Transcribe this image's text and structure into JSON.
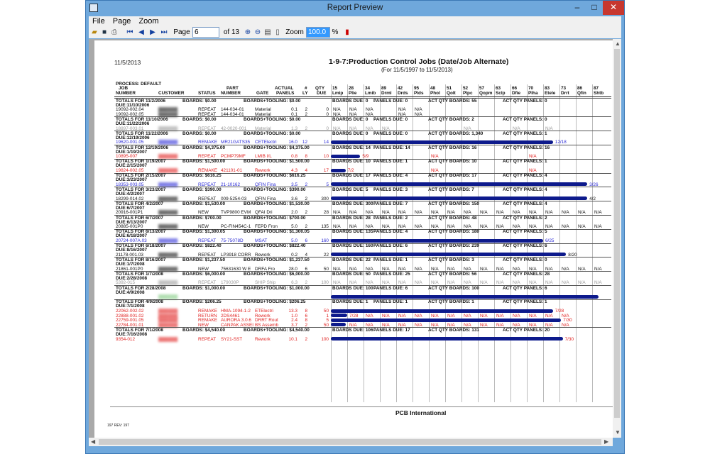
{
  "window": {
    "title": "Report Preview",
    "minimize": "–",
    "maximize": "□",
    "close": "✕"
  },
  "menu": [
    "File",
    "Page",
    "Zoom"
  ],
  "toolbar": {
    "page_label": "Page",
    "page_value": "6",
    "of_label": "of 13",
    "zoom_label": "Zoom",
    "zoom_value": "100.0",
    "percent": "%"
  },
  "report": {
    "date": "11/5/2013",
    "title": "1-9-7:Production Control Jobs (Date/Job Alternate)",
    "subtitle": "(For 11/5/1997 to 11/5/2013)",
    "process": "PROCESS: DEFAULT",
    "footer_company": "PCB International",
    "footer_rev": "197  REV:  197"
  },
  "columns": {
    "job": "JOB",
    "job2": "NUMBER",
    "customer": "CUSTOMER",
    "status": "STATUS",
    "part": "PART",
    "part2": "NUMBER",
    "gate": "GATE",
    "actual": "ACTUAL",
    "panels": "PANELS",
    "num": "#",
    "ly": "LY",
    "qty": "QTY",
    "due": "DUE",
    "stations": [
      {
        "n": "15",
        "name": "Lmip"
      },
      {
        "n": "28",
        "name": "Plie"
      },
      {
        "n": "34",
        "name": "Lmib"
      },
      {
        "n": "89",
        "name": "Drml"
      },
      {
        "n": "42",
        "name": "Drds"
      },
      {
        "n": "95",
        "name": "Plds"
      },
      {
        "n": "48",
        "name": "Phol"
      },
      {
        "n": "51",
        "name": "Qolt"
      },
      {
        "n": "52",
        "name": "Plpc"
      },
      {
        "n": "57",
        "name": "Qopm"
      },
      {
        "n": "63",
        "name": "Sclp"
      },
      {
        "n": "66",
        "name": "Dfie"
      },
      {
        "n": "70",
        "name": "Plha"
      },
      {
        "n": "83",
        "name": "Etele"
      },
      {
        "n": "73",
        "name": "Drrt"
      },
      {
        "n": "86",
        "name": "Qfin"
      },
      {
        "n": "87",
        "name": "Shtb"
      }
    ]
  },
  "rows": [
    {
      "t": "total",
      "text": "TOTALS FOR 11/2/2006",
      "boards": "BOARDS: $0.00",
      "tool": "BOARDS+TOOLING: $0.00",
      "bd": "BOARDS DUE: 0",
      "pd": "PANELS DUE: 0",
      "aqb": "ACT QTY BOARDS: 55",
      "aqp": "ACT QTY PANELS: 0"
    },
    {
      "t": "due",
      "text": "DUE:11/10/2006"
    },
    {
      "t": "job",
      "c": "#111",
      "job": "19092-002.04",
      "st": "REPEAT",
      "part": "144-034-01",
      "gate": "Material",
      "act": "0.1",
      "n": "2",
      "qty": "0",
      "cells": [
        "N/A",
        "N/A",
        "N/A",
        "",
        "N/A",
        "N/A"
      ]
    },
    {
      "t": "job",
      "c": "#111",
      "job": "19092-002.05",
      "st": "REPEAT",
      "part": "144-034-01",
      "gate": "Material",
      "act": "0.1",
      "n": "2",
      "qty": "0",
      "cells": [
        "N/A",
        "N/A",
        "N/A",
        "",
        "N/A",
        "N/A"
      ]
    },
    {
      "t": "total",
      "text": "TOTALS FOR 11/10/2006",
      "boards": "BOARDS: $0.00",
      "tool": "BOARDS+TOOLING: $0.00",
      "bd": "BOARDS DUE: 0",
      "pd": "PANELS DUE: 0",
      "aqb": "ACT QTY BOARDS: 2",
      "aqp": "ACT QTY PANELS: 0"
    },
    {
      "t": "due",
      "text": "DUE:11/22/2006"
    },
    {
      "t": "job",
      "c": "#999",
      "job": "18897-003.01",
      "st": "REPEAT",
      "part": "42-0020-001",
      "gate": "Material",
      "act": "1.3",
      "n": "2",
      "qty": "0",
      "cells": [
        "N/A",
        "N/A",
        "N/A",
        "N/A",
        "",
        "",
        "",
        "",
        "N/A",
        "",
        "",
        "N/A",
        "",
        "N/A"
      ]
    },
    {
      "t": "total",
      "text": "TOTALS FOR 11/22/2006",
      "boards": "BOARDS: $0.00",
      "tool": "BOARDS+TOOLING: $0.00",
      "bd": "BOARDS DUE: 0",
      "pd": "PANELS DUE: 0",
      "aqb": "ACT QTY BOARDS: 1,340",
      "aqp": "ACT QTY PANELS: 1"
    },
    {
      "t": "due",
      "text": "DUE:12/19/2006"
    },
    {
      "t": "job",
      "c": "#2b2bd6",
      "job": "19620-001.05",
      "st": "REMAKE",
      "part": "MR21GATS35",
      "gate": "CETElectri",
      "act": "16.0",
      "n": "12",
      "qty": "14",
      "bar": [
        0,
        13.6
      ],
      "lbl": "12/18"
    },
    {
      "t": "total",
      "text": "TOTALS FOR 12/19/2006",
      "boards": "BOARDS: $4,375.00",
      "tool": "BOARDS+TOOLING: $4,375.00",
      "bd": "BOARDS DUE: 14",
      "pd": "PANELS DUE: 14",
      "aqb": "ACT QTY BOARDS: 16",
      "aqp": "ACT QTY PANELS: 16"
    },
    {
      "t": "due",
      "text": "DUE:1/19/2007"
    },
    {
      "t": "job",
      "c": "#e0201f",
      "job": "10895-007",
      "st": "REPEAT",
      "part": "PCMP79MF",
      "gate": "LMIB I/L",
      "act": "0.8",
      "n": "8",
      "qty": "10",
      "bar": [
        0,
        1.8
      ],
      "lbl": "5/9",
      "cells": [
        "",
        "",
        "",
        "",
        "",
        "",
        "N/A",
        "",
        "",
        "",
        "",
        "",
        "N/A"
      ]
    },
    {
      "t": "total",
      "text": "TOTALS FOR 1/19/2007",
      "boards": "BOARDS: $1,500.00",
      "tool": "BOARDS+TOOLING: $1,500.00",
      "bd": "BOARDS DUE: 10",
      "pd": "PANELS DUE: 1",
      "aqb": "ACT QTY BOARDS: 10",
      "aqp": "ACT QTY PANELS: 1"
    },
    {
      "t": "due",
      "text": "DUE:2/15/2007"
    },
    {
      "t": "job",
      "c": "#e0201f",
      "job": "19824-002.05",
      "st": "REMAKE",
      "part": "421101-01",
      "gate": "Rework",
      "act": "4.3",
      "n": "4",
      "qty": "17",
      "bar": [
        0,
        0.9
      ],
      "lbl": "7/2",
      "cells": [
        "",
        "",
        "",
        "",
        "",
        "",
        "N/A",
        "",
        "",
        "",
        "",
        "",
        "N/A"
      ]
    },
    {
      "t": "total",
      "text": "TOTALS FOR 2/15/2007",
      "boards": "BOARDS: $616.25",
      "tool": "BOARDS+TOOLING: $616.25",
      "bd": "BOARDS DUE: 17",
      "pd": "PANELS DUE: 4",
      "aqb": "ACT QTY BOARDS: 17",
      "aqp": "ACT QTY PANELS: 4"
    },
    {
      "t": "due",
      "text": "DUE:3/23/2007"
    },
    {
      "t": "job",
      "c": "#2b2bd6",
      "job": "18353-003.05",
      "st": "REPEAT",
      "part": "21-10162",
      "gate": "QFIN Fina",
      "act": "3.5",
      "n": "2",
      "qty": "5",
      "bar": [
        0,
        15.7
      ],
      "lbl": "3/26"
    },
    {
      "t": "total",
      "text": "TOTALS FOR 3/23/2007",
      "boards": "BOARDS: $390.00",
      "tool": "BOARDS+TOOLING: $390.00",
      "bd": "BOARDS DUE: 5",
      "pd": "PANELS DUE: 3",
      "aqb": "ACT QTY BOARDS: 7",
      "aqp": "ACT QTY PANELS: 4"
    },
    {
      "t": "due",
      "text": "DUE:4/2/2007"
    },
    {
      "t": "job",
      "c": "#111",
      "job": "18299-014.02",
      "st": "REPEAT",
      "part": "009-5254-03",
      "gate": "QFIN Fina",
      "act": "3.6",
      "n": "2",
      "qty": "300",
      "bar": [
        0,
        15.7
      ],
      "lbl": "4/2"
    },
    {
      "t": "total",
      "text": "TOTALS FOR 4/2/2007",
      "boards": "BOARDS: $1,530.00",
      "tool": "BOARDS+TOOLING: $1,530.00",
      "bd": "BOARDS DUE: 300",
      "pd": "PANELS DUE: 7",
      "aqb": "ACT QTY BOARDS: 150",
      "aqp": "ACT QTY PANELS: 4"
    },
    {
      "t": "due",
      "text": "DUE:6/7/2007"
    },
    {
      "t": "job",
      "c": "#111",
      "job": "20916-001P1",
      "st": "NEW",
      "part": "TVP9800 EVM",
      "gate": "QFAI Dri",
      "act": "2.0",
      "n": "2",
      "qty": "28",
      "cells": [
        "N/A",
        "N/A",
        "N/A",
        "N/A",
        "N/A",
        "N/A",
        "N/A",
        "N/A",
        "N/A",
        "N/A",
        "N/A",
        "N/A",
        "N/A",
        "N/A",
        "N/A",
        "N/A",
        "N/A"
      ]
    },
    {
      "t": "total",
      "text": "TOTALS FOR 6/7/2007",
      "boards": "BOARDS: $700.00",
      "tool": "BOARDS+TOOLING: $700.00",
      "bd": "BOARDS DUE: 28",
      "pd": "PANELS DUE: 2",
      "aqb": "ACT QTY BOARDS: 48",
      "aqp": "ACT QTY PANELS: 2"
    },
    {
      "t": "due",
      "text": "DUE:6/13/2007"
    },
    {
      "t": "job",
      "c": "#111",
      "job": "20885-001P0",
      "st": "NEW",
      "part": "PC-FIN454C-1",
      "gate": "FEPD Fron",
      "act": "5.0",
      "n": "2",
      "qty": "135",
      "cells": [
        "N/A",
        "N/A",
        "N/A",
        "N/A",
        "N/A",
        "N/A",
        "N/A",
        "N/A",
        "N/A",
        "N/A",
        "N/A",
        "N/A",
        "N/A",
        "N/A",
        "N/A",
        "N/A",
        "N/A"
      ]
    },
    {
      "t": "total",
      "text": "TOTALS FOR 6/13/2007",
      "boards": "BOARDS: $1,300.05",
      "tool": "BOARDS+TOOLING: $1,300.05",
      "bd": "BOARDS DUE: 135",
      "pd": "PANELS DUE: 4",
      "aqb": "ACT QTY BOARDS: 180",
      "aqp": "ACT QTY PANELS: 5"
    },
    {
      "t": "due",
      "text": "DUE:6/18/2007"
    },
    {
      "t": "job",
      "c": "#2b2bd6",
      "job": "20724-007A.03",
      "st": "REPEAT",
      "part": "75-75078D",
      "gate": "MSAT",
      "act": "5.0",
      "n": "6",
      "qty": "160",
      "bar": [
        0,
        13.0
      ],
      "lbl": "6/25"
    },
    {
      "t": "total",
      "text": "TOTALS FOR 6/18/2007",
      "boards": "BOARDS: $822.40",
      "tool": "BOARDS+TOOLING: $822.40",
      "bd": "BOARDS DUE: 160",
      "pd": "PANELS DUE: 6",
      "aqb": "ACT QTY BOARDS: 239",
      "aqp": "ACT QTY PANELS: 6"
    },
    {
      "t": "due",
      "text": "DUE:8/16/2007"
    },
    {
      "t": "job",
      "c": "#111",
      "job": "21178-001.03",
      "st": "REPEAT",
      "part": "LP3918 CORR",
      "gate": "Rework",
      "act": "0.2",
      "n": "4",
      "qty": "22",
      "bar": [
        0,
        14.4
      ],
      "lbl": "8/20"
    },
    {
      "t": "total",
      "text": "TOTALS FOR 8/16/2007",
      "boards": "BOARDS: $1,237.50",
      "tool": "BOARDS+TOOLING: $1,237.50",
      "bd": "BOARDS DUE: 22",
      "pd": "PANELS DUE: 1",
      "aqb": "ACT QTY BOARDS: 3",
      "aqp": "ACT QTY PANELS: 0"
    },
    {
      "t": "due",
      "text": "DUE:1/7/2008"
    },
    {
      "t": "job",
      "c": "#111",
      "job": "21861-001P0",
      "st": "NEW",
      "part": "75631630 W E",
      "gate": "DRFA Fro",
      "act": "28.0",
      "n": "6",
      "qty": "50",
      "cells": [
        "N/A",
        "N/A",
        "N/A",
        "N/A",
        "N/A",
        "N/A",
        "N/A",
        "N/A",
        "N/A",
        "N/A",
        "N/A",
        "N/A",
        "N/A",
        "N/A",
        "N/A",
        "N/A",
        "N/A"
      ]
    },
    {
      "t": "total",
      "text": "TOTALS FOR 1/7/2008",
      "boards": "BOARDS: $6,000.00",
      "tool": "BOARDS+TOOLING: $6,000.00",
      "bd": "BOARDS DUE: 50",
      "pd": "PANELS DUE: 25",
      "aqb": "ACT QTY BOARDS: 56",
      "aqp": "ACT QTY PANELS: 28"
    },
    {
      "t": "due",
      "text": "DUE:2/28/2008"
    },
    {
      "t": "job",
      "c": "#999",
      "job": "5392-015",
      "st": "REPEAT",
      "part": "179030P",
      "gate": "SHIP Ship",
      "act": "6.3",
      "n": "2",
      "qty": "100",
      "cells": [
        "N/A",
        "N/A",
        "N/A",
        "N/A",
        "N/A",
        "N/A",
        "N/A",
        "N/A",
        "N/A",
        "N/A",
        "N/A",
        "N/A",
        "N/A",
        "N/A",
        "N/A",
        "N/A",
        "N/A"
      ]
    },
    {
      "t": "total",
      "text": "TOTALS FOR 2/28/2008",
      "boards": "BOARDS: $1,000.00",
      "tool": "BOARDS+TOOLING: $1,000.00",
      "bd": "BOARDS DUE: 100",
      "pd": "PANELS DUE: 6",
      "aqb": "ACT QTY BOARDS: 100",
      "aqp": "ACT QTY PANELS: 6"
    },
    {
      "t": "due",
      "text": "DUE:4/9/2008"
    },
    {
      "t": "job",
      "c": "#7fc97f",
      "job": "",
      "st": "",
      "part": "",
      "gate": "",
      "act": "",
      "n": "",
      "qty": "",
      "bar": [
        0,
        16.4
      ],
      "lbl": ""
    },
    {
      "t": "total",
      "text": "TOTALS FOR 4/9/2008",
      "boards": "BOARDS: $206.25",
      "tool": "BOARDS+TOOLING: $206.25",
      "bd": "BOARDS DUE: 1",
      "pd": "PANELS DUE: 1",
      "aqb": "ACT QTY BOARDS: 1",
      "aqp": "ACT QTY PANELS: 1"
    },
    {
      "t": "due",
      "text": "DUE:7/1/2008"
    },
    {
      "t": "job",
      "c": "#e0201f",
      "job": "22062-002.02",
      "st": "REMAKE",
      "part": "HMA-1094-1-2",
      "gate": "ETElectri",
      "act": "13.3",
      "n": "8",
      "qty": "50",
      "bar": [
        0,
        13.6
      ],
      "lbl": "7/28"
    },
    {
      "t": "job",
      "c": "#e0201f",
      "job": "22888-001.02",
      "st": "RETURN",
      "part": "2DS4461",
      "gate": "Rework",
      "act": "1.0",
      "n": "6",
      "qty": "1",
      "bar": [
        0,
        1.0
      ],
      "lbl": "7/28",
      "cells": [
        "",
        "",
        "N/A",
        "N/A",
        "N/A",
        "N/A",
        "N/A",
        "N/A",
        "N/A",
        "N/A",
        "N/A",
        "N/A",
        "N/A",
        "N/A",
        "N/A"
      ]
    },
    {
      "t": "job",
      "c": "#e0201f",
      "job": "22759-001.05",
      "st": "REMAKE",
      "part": "AURORA 3.0.6",
      "gate": "DRRT Rout",
      "act": "2.4",
      "n": "8",
      "qty": "5",
      "bar": [
        0,
        14.1
      ],
      "lbl": "7/30"
    },
    {
      "t": "job",
      "c": "#e0201f",
      "job": "22784-001.01",
      "st": "NEW",
      "part": "CANPAK ASSEI",
      "gate": "BS Assemb",
      "act": "3.7",
      "n": "2",
      "qty": "50",
      "bar": [
        0,
        0.9
      ],
      "lbl": "",
      "cells": [
        "",
        "N/A",
        "N/A",
        "N/A",
        "N/A",
        "N/A",
        "N/A",
        "N/A",
        "N/A",
        "N/A",
        "N/A",
        "N/A",
        "N/A",
        "N/A",
        "N/A"
      ]
    },
    {
      "t": "total",
      "text": "TOTALS FOR 7/1/2008",
      "boards": "BOARDS: $4,540.00",
      "tool": "BOARDS+TOOLING: $4,540.00",
      "bd": "BOARDS DUE: 106",
      "pd": "PANELS DUE: 17",
      "aqb": "ACT QTY BOARDS: 131",
      "aqp": "ACT QTY PANELS: 20"
    },
    {
      "t": "due",
      "text": "DUE:7/16/2008"
    },
    {
      "t": "job",
      "c": "#e0201f",
      "job": "9354-012",
      "st": "REPEAT",
      "part": "SY21-SST",
      "gate": "Rework",
      "act": "10.1",
      "n": "2",
      "qty": "100",
      "bar": [
        0,
        14.2
      ],
      "lbl": "7/30"
    }
  ]
}
